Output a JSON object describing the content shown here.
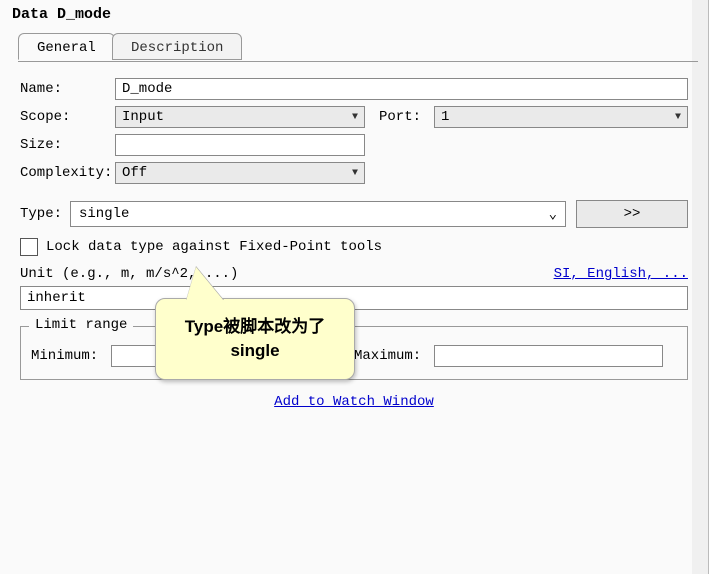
{
  "title": "Data D_mode",
  "tabs": {
    "general": "General",
    "description": "Description"
  },
  "labels": {
    "name": "Name:",
    "scope": "Scope:",
    "port": "Port:",
    "size": "Size:",
    "complexity": "Complexity:",
    "type": "Type:",
    "lock": "Lock data type against Fixed-Point tools",
    "unit_hint": "Unit (e.g., m, m/s^2, ...)",
    "unit_link": "SI, English, ...",
    "limit_range": "Limit range",
    "minimum": "Minimum:",
    "maximum": "Maximum:",
    "watch": "Add to Watch Window",
    "more_btn": ">>"
  },
  "values": {
    "name": "D_mode",
    "scope": "Input",
    "port": "1",
    "size": "",
    "complexity": "Off",
    "type": "single",
    "inherit": "inherit",
    "minimum": "",
    "maximum": ""
  },
  "callout": "Type被脚本改为了single"
}
